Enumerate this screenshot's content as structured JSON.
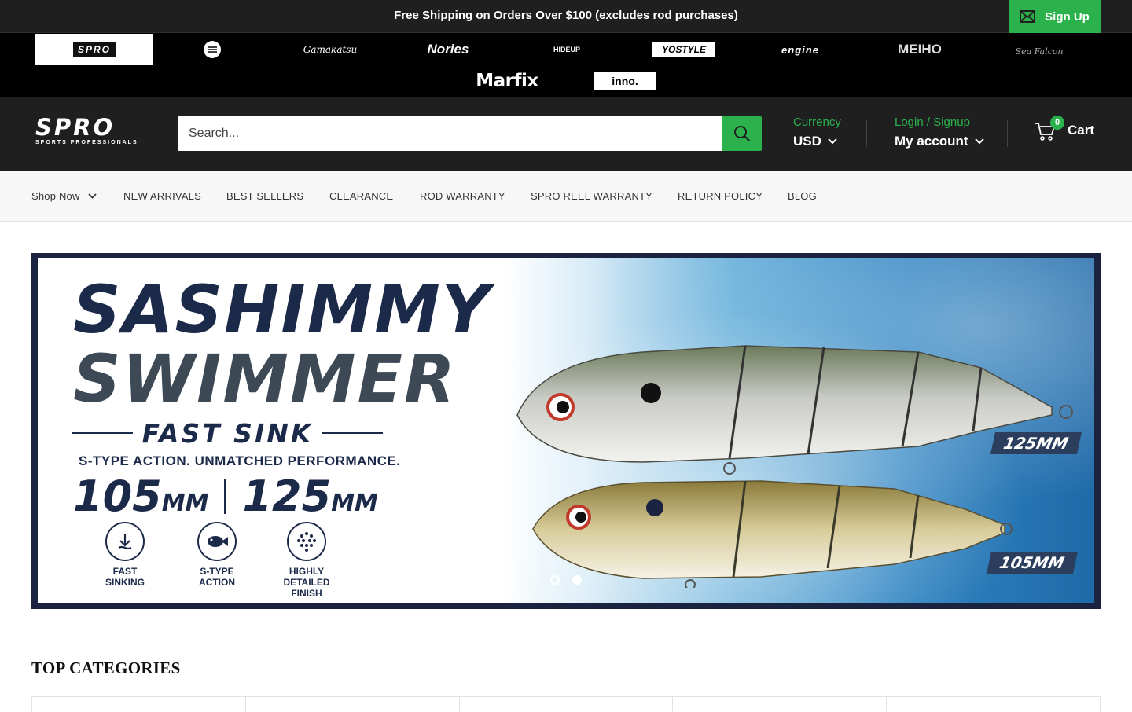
{
  "announcement": {
    "text": "Free Shipping on Orders Over $100 (excludes rod purchases)",
    "signup_label": "Sign Up",
    "signup_icon": "envelope-icon"
  },
  "brands": [
    {
      "name": "SPRO",
      "text": "SPRO"
    },
    {
      "name": "S-logo",
      "text": "S"
    },
    {
      "name": "Gamakatsu",
      "text": "Gamakatsu"
    },
    {
      "name": "Nories",
      "text": "Nories"
    },
    {
      "name": "Hideup",
      "text": "HIDEUP"
    },
    {
      "name": "YO-Style",
      "text": "YOSTYLE"
    },
    {
      "name": "Engine",
      "text": "engine"
    },
    {
      "name": "Meiho",
      "text": "MEIHO"
    },
    {
      "name": "Sea Falcon",
      "text": "Sea Falcon"
    },
    {
      "name": "Marfix",
      "text": "Marfix"
    },
    {
      "name": "Inno",
      "text": "inno."
    }
  ],
  "header": {
    "logo_text": "SPRO",
    "logo_subtext": "SPORTS PROFESSIONALS",
    "search_placeholder": "Search...",
    "currency_label": "Currency",
    "currency_value": "USD",
    "login_label": "Login / Signup",
    "account_label": "My account",
    "cart_count": "0",
    "cart_label": "Cart"
  },
  "nav": {
    "items": [
      "Shop Now",
      "NEW ARRIVALS",
      "BEST SELLERS",
      "CLEARANCE",
      "ROD WARRANTY",
      "SPRO REEL WARRANTY",
      "RETURN POLICY",
      "BLOG"
    ]
  },
  "hero": {
    "title_line1": "SASHIMMY",
    "title_line2": "SWIMMER",
    "subtitle": "FAST SINK",
    "tagline": "S-TYPE ACTION. UNMATCHED PERFORMANCE.",
    "size1_num": "105",
    "size1_unit": "MM",
    "size2_num": "125",
    "size2_unit": "MM",
    "features": [
      {
        "label_1": "FAST",
        "label_2": "SINKING",
        "label_3": "",
        "icon": "sink-arrow-icon"
      },
      {
        "label_1": "S-TYPE",
        "label_2": "ACTION",
        "label_3": "",
        "icon": "fish-icon"
      },
      {
        "label_1": "HIGHLY",
        "label_2": "DETAILED",
        "label_3": "FINISH",
        "icon": "dots-icon"
      }
    ],
    "tag_large": "125MM",
    "tag_small": "105MM",
    "slides": 2,
    "active_slide": 2
  },
  "categories": {
    "title": "TOP CATEGORIES"
  },
  "colors": {
    "accent": "#2bb24c",
    "dark": "#1f1f1f",
    "navy": "#1c2a4a"
  }
}
